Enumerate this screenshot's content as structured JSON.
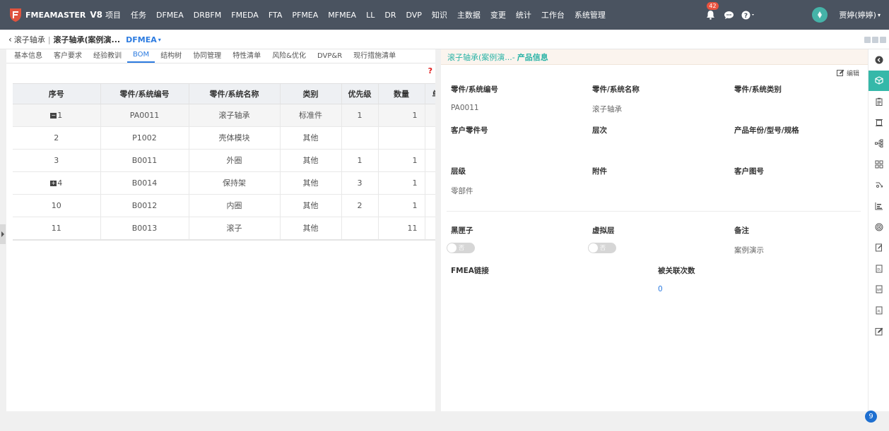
{
  "nav": {
    "logo": "FMEAMASTER",
    "version": "V8",
    "menu": [
      "项目",
      "任务",
      "DFMEA",
      "DRBFM",
      "FMEDA",
      "FTA",
      "PFMEA",
      "MFMEA",
      "LL",
      "DR",
      "DVP",
      "知识",
      "主数据",
      "变更",
      "统计",
      "工作台",
      "系统管理"
    ],
    "notification_count": "42",
    "username": "贾婷(婷婷)"
  },
  "breadcrumb": {
    "item1": "滚子轴承",
    "sep": "|",
    "item2": "滚子轴承(案例演...",
    "tag": "DFMEA"
  },
  "tabs": [
    "基本信息",
    "客户要求",
    "经验教训",
    "BOM",
    "结构树",
    "协同管理",
    "特性清单",
    "风险&优化",
    "DVP&R",
    "现行措施清单"
  ],
  "active_tab": "BOM",
  "help": "?",
  "bom_table": {
    "headers": [
      "序号",
      "零件/系统编号",
      "零件/系统名称",
      "类别",
      "优先级",
      "数量",
      "单"
    ],
    "rows": [
      {
        "seq": "1",
        "expand": "minus",
        "code": "PA0011",
        "name": "滚子轴承",
        "category": "标准件",
        "priority": "1",
        "qty": "1"
      },
      {
        "seq": "2",
        "expand": "",
        "code": "P1002",
        "name": "壳体模块",
        "category": "其他",
        "priority": "",
        "qty": ""
      },
      {
        "seq": "3",
        "expand": "",
        "code": "B0011",
        "name": "外圈",
        "category": "其他",
        "priority": "1",
        "qty": "1"
      },
      {
        "seq": "4",
        "expand": "plus",
        "code": "B0014",
        "name": "保持架",
        "category": "其他",
        "priority": "3",
        "qty": "1"
      },
      {
        "seq": "10",
        "expand": "",
        "code": "B0012",
        "name": "内圈",
        "category": "其他",
        "priority": "2",
        "qty": "1"
      },
      {
        "seq": "11",
        "expand": "",
        "code": "B0013",
        "name": "滚子",
        "category": "其他",
        "priority": "",
        "qty": "11"
      }
    ]
  },
  "detail": {
    "title": "滚子轴承(案例演...-",
    "title_bold": "产品信息",
    "edit": "编辑",
    "fields": {
      "part_code_label": "零件/系统编号",
      "part_code": "PA0011",
      "part_name_label": "零件/系统名称",
      "part_name": "滚子轴承",
      "part_type_label": "零件/系统类别",
      "part_type": "",
      "cust_part_label": "客户零件号",
      "cust_part": "",
      "level_label": "层次",
      "level": "",
      "model_label": "产品年份/型号/规格",
      "model": "",
      "grade_label": "层级",
      "grade": "零部件",
      "attach_label": "附件",
      "attach": "",
      "cust_drawing_label": "客户图号",
      "cust_drawing": "",
      "blackbox_label": "黑匣子",
      "blackbox_toggle": "否",
      "virtual_label": "虚拟层",
      "virtual_toggle": "否",
      "remark_label": "备注",
      "remark": "案例演示",
      "fmea_link_label": "FMEA链接",
      "linked_count_label": "被关联次数",
      "linked_count": "0"
    }
  },
  "page_badge": "9"
}
